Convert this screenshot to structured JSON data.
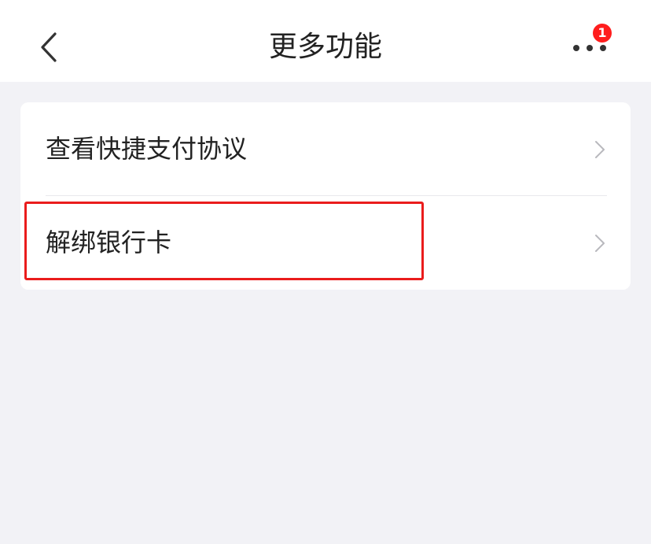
{
  "header": {
    "title": "更多功能",
    "back_icon": "chevron-left-icon",
    "more_icon": "ellipsis-icon",
    "notification_count": "1",
    "badge_color": "#ff1d1d"
  },
  "menu": {
    "items": [
      {
        "label": "查看快捷支付协议",
        "icon": "chevron-right-icon"
      },
      {
        "label": "解绑银行卡",
        "icon": "chevron-right-icon"
      }
    ]
  },
  "colors": {
    "background": "#f2f2f6",
    "card": "#ffffff",
    "text": "#222222",
    "highlight": "#ea1c1c"
  }
}
